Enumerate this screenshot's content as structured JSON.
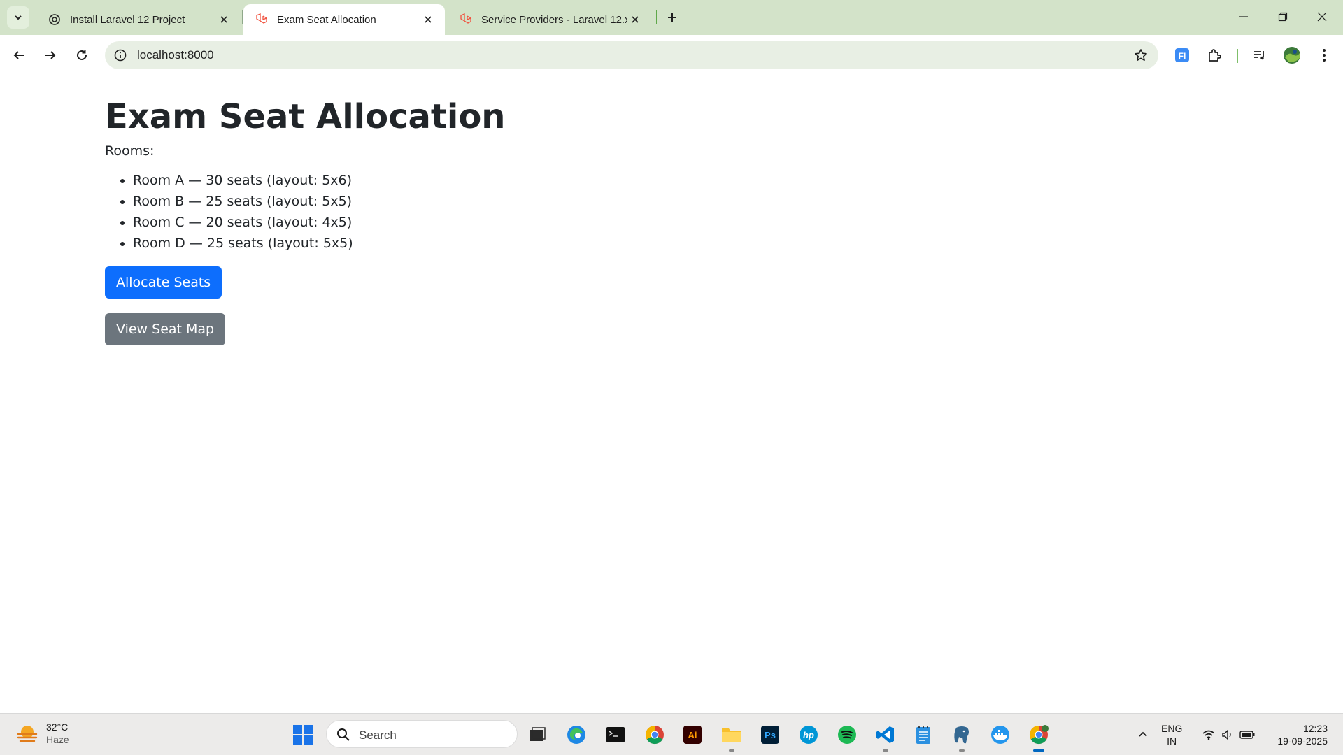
{
  "browser": {
    "tabs": [
      {
        "title": "Install Laravel 12 Project",
        "active": false
      },
      {
        "title": "Exam Seat Allocation",
        "active": true
      },
      {
        "title": "Service Providers - Laravel 12.x",
        "active": false
      }
    ],
    "url": "localhost:8000",
    "accent": "#d3e3c9"
  },
  "page": {
    "heading": "Exam Seat Allocation",
    "rooms_label": "Rooms:",
    "rooms": [
      "Room A — 30 seats (layout: 5x6)",
      "Room B — 25 seats (layout: 5x5)",
      "Room C — 20 seats (layout: 4x5)",
      "Room D — 25 seats (layout: 5x5)"
    ],
    "allocate_button": "Allocate Seats",
    "view_map_button": "View Seat Map",
    "colors": {
      "primary": "#0d6efd",
      "secondary": "#6c757d"
    }
  },
  "taskbar": {
    "weather_temp": "32°C",
    "weather_condition": "Haze",
    "search_placeholder": "Search",
    "language": "ENG",
    "region": "IN",
    "time": "12:23",
    "date": "19-09-2025",
    "apps": [
      "task-view",
      "edge",
      "terminal",
      "chrome",
      "illustrator",
      "file-explorer",
      "photoshop",
      "hp",
      "spotify",
      "vscode",
      "notepad",
      "postgres",
      "docker",
      "chrome-active"
    ]
  }
}
